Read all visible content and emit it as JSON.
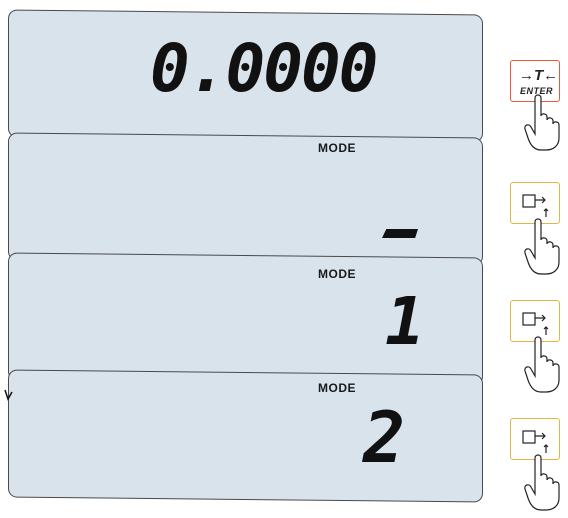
{
  "panels": [
    {
      "id": "reading",
      "label": "",
      "value": "0.0000"
    },
    {
      "id": "mode-blank",
      "label": "MODE",
      "value": "–"
    },
    {
      "id": "mode-1",
      "label": "MODE",
      "value": "1"
    },
    {
      "id": "mode-2",
      "label": "MODE",
      "value": "2"
    }
  ],
  "keys": [
    {
      "symbol": "→T←",
      "caption": "ENTER",
      "icon": "tare-enter-icon"
    },
    {
      "symbol": "",
      "caption": "",
      "icon": "print-up-icon"
    },
    {
      "symbol": "",
      "caption": "",
      "icon": "print-up-icon"
    },
    {
      "symbol": "",
      "caption": "",
      "icon": "print-up-icon"
    }
  ],
  "colors": {
    "panel": "#d9e3ec",
    "key_border": "#e0b64a",
    "key_enter_border": "#e45a3a"
  }
}
